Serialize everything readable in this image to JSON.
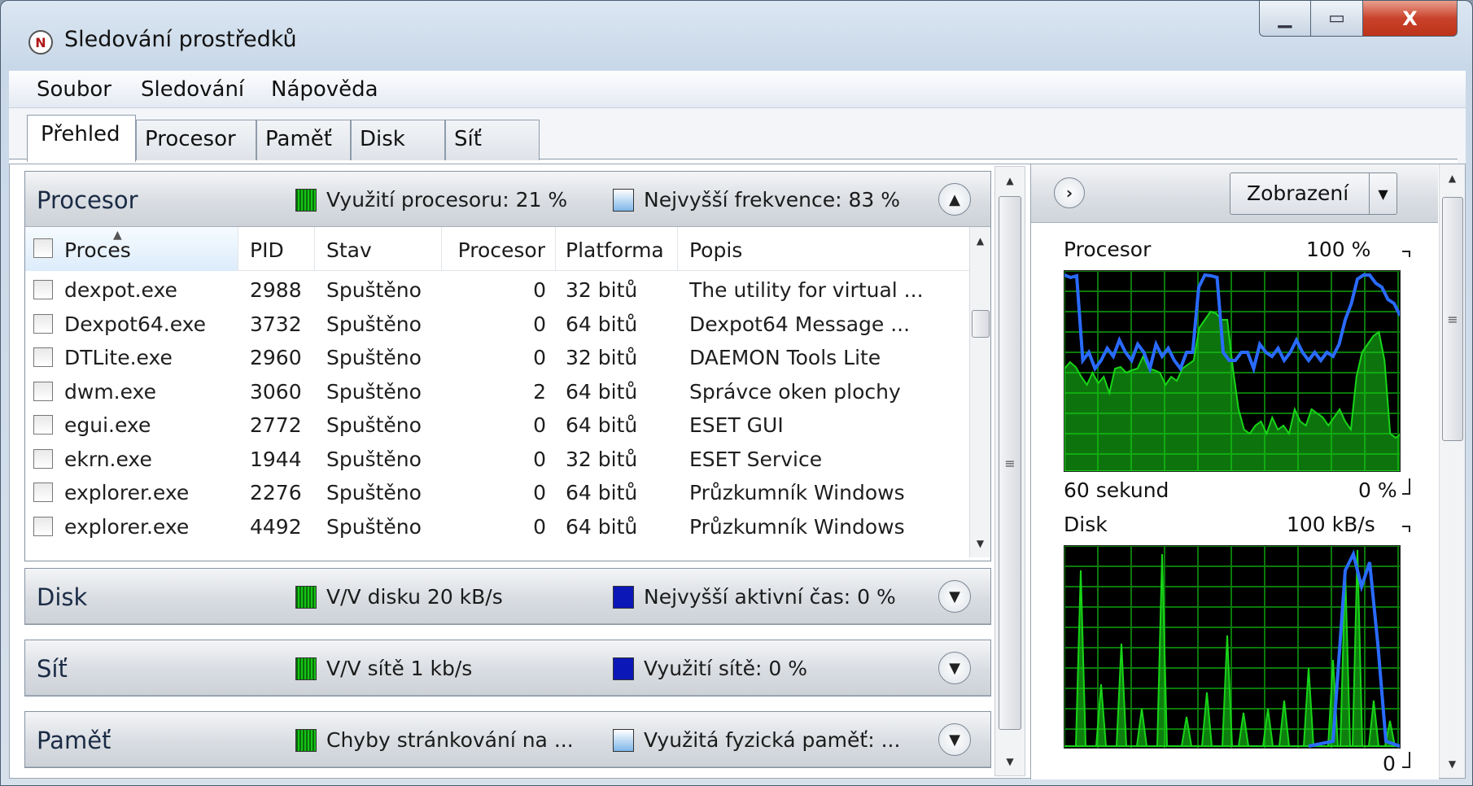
{
  "window": {
    "title": "Sledování prostředků"
  },
  "menu": [
    "Soubor",
    "Sledování",
    "Nápověda"
  ],
  "tabs": [
    "Přehled",
    "Procesor",
    "Paměť",
    "Disk",
    "Síť"
  ],
  "sections": {
    "procesor": {
      "title": "Procesor",
      "legend1": "Využití procesoru: 21 %",
      "legend2": "Nejvyšší frekvence: 83 %"
    },
    "disk": {
      "title": "Disk",
      "legend1": "V/V disku 20 kB/s",
      "legend2": "Nejvyšší aktivní čas: 0 %"
    },
    "sit": {
      "title": "Síť",
      "legend1": "V/V sítě 1 kb/s",
      "legend2": "Využití sítě: 0 %"
    },
    "pamet": {
      "title": "Paměť",
      "legend1": "Chyby stránkování na ...",
      "legend2": "Využitá fyzická paměť: ..."
    }
  },
  "table": {
    "headers": [
      "Proces",
      "PID",
      "Stav",
      "Procesor",
      "Platforma",
      "Popis"
    ],
    "rows": [
      [
        "dexpot.exe",
        "2988",
        "Spuštěno",
        "0",
        "32 bitů",
        "The utility for virtual ..."
      ],
      [
        "Dexpot64.exe",
        "3732",
        "Spuštěno",
        "0",
        "64 bitů",
        "Dexpot64 Message ..."
      ],
      [
        "DTLite.exe",
        "2960",
        "Spuštěno",
        "0",
        "32 bitů",
        "DAEMON Tools Lite"
      ],
      [
        "dwm.exe",
        "3060",
        "Spuštěno",
        "2",
        "64 bitů",
        "Správce oken plochy"
      ],
      [
        "egui.exe",
        "2772",
        "Spuštěno",
        "0",
        "64 bitů",
        "ESET GUI"
      ],
      [
        "ekrn.exe",
        "1944",
        "Spuštěno",
        "0",
        "32 bitů",
        "ESET Service"
      ],
      [
        "explorer.exe",
        "2276",
        "Spuštěno",
        "0",
        "64 bitů",
        "Průzkumník Windows"
      ],
      [
        "explorer.exe",
        "4492",
        "Spuštěno",
        "0",
        "64 bitů",
        "Průzkumník Windows"
      ]
    ]
  },
  "right": {
    "view_label": "Zobrazení",
    "cpu_graph": {
      "title": "Procesor",
      "max": "100 %",
      "time": "60 sekund",
      "min": "0 %"
    },
    "disk_graph": {
      "title": "Disk",
      "max": "100 kB/s",
      "min": "0"
    }
  },
  "colors": {
    "graph_green": "#18d418",
    "graph_blue": "#2a6bff",
    "graph_grid": "#0b7a0b"
  },
  "icons": {
    "app": "resource-monitor-icon",
    "expand_up": "chevron-up-icon",
    "expand_down": "chevron-down-icon",
    "nav": "chevron-right-icon"
  }
}
